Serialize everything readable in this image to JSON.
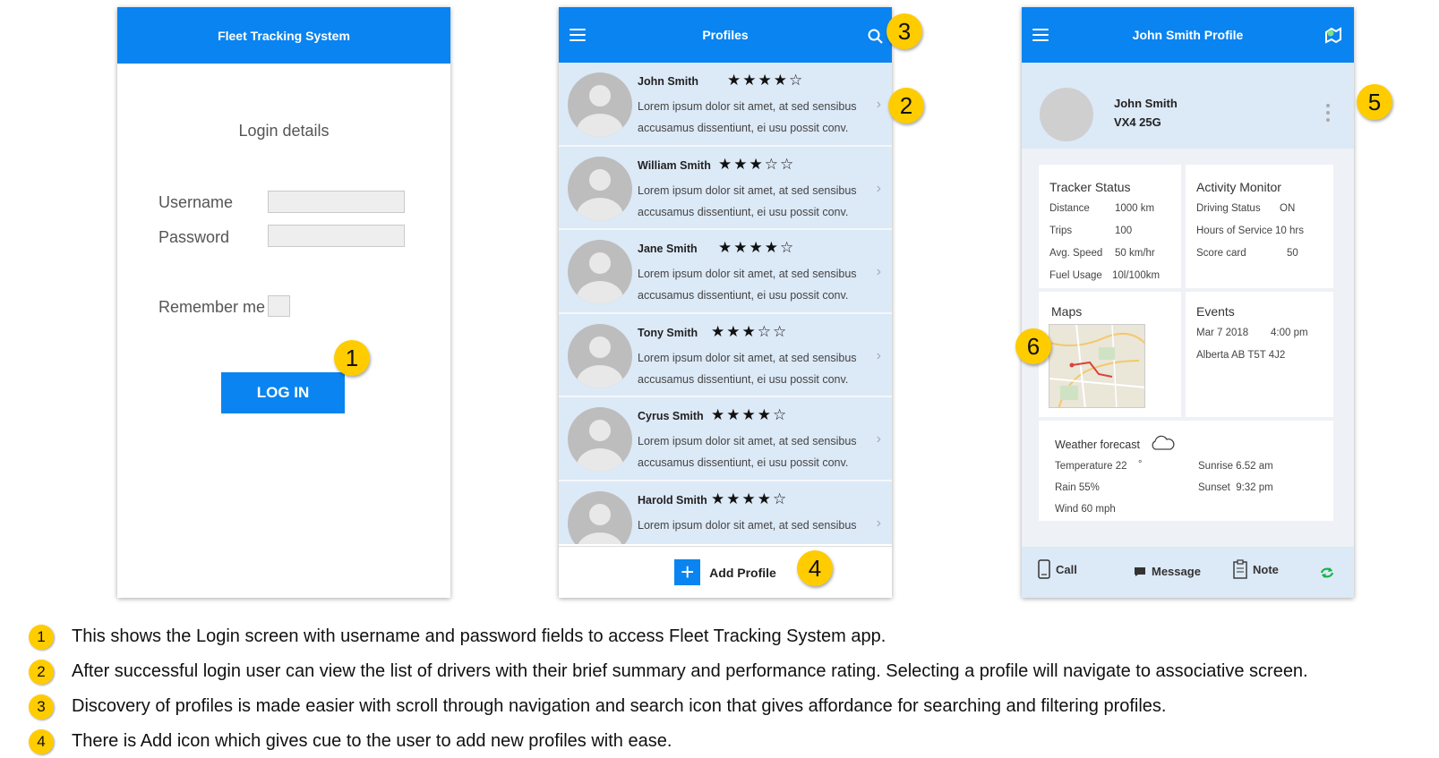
{
  "login": {
    "title": "Fleet Tracking System",
    "heading": "Login details",
    "username_label": "Username",
    "password_label": "Password",
    "remember_label": "Remember me",
    "login_button": "LOG IN"
  },
  "profiles": {
    "title": "Profiles",
    "items": [
      {
        "name": "John Smith",
        "rating": 4,
        "line1": "Lorem ipsum dolor sit amet, at sed sensibus",
        "line2": "accusamus dissentiunt, ei usu possit conv."
      },
      {
        "name": "William Smith",
        "rating": 3,
        "line1": "Lorem ipsum dolor sit amet, at sed sensibus",
        "line2": "accusamus dissentiunt, ei usu possit conv."
      },
      {
        "name": "Jane Smith",
        "rating": 4,
        "line1": "Lorem ipsum dolor sit amet, at sed sensibus",
        "line2": "accusamus dissentiunt, ei usu possit conv."
      },
      {
        "name": "Tony Smith",
        "rating": 3,
        "line1": "Lorem ipsum dolor sit amet, at sed sensibus",
        "line2": "accusamus dissentiunt, ei usu possit conv."
      },
      {
        "name": "Cyrus Smith",
        "rating": 4,
        "line1": "Lorem ipsum dolor sit amet, at sed sensibus",
        "line2": "accusamus dissentiunt, ei usu possit conv."
      },
      {
        "name": "Harold Smith",
        "rating": 4,
        "line1": "Lorem ipsum dolor sit amet, at sed sensibus",
        "line2": ""
      }
    ],
    "add_label": "Add Profile"
  },
  "detail": {
    "title": "John Smith Profile",
    "name": "John Smith",
    "plate": "VX4 25G",
    "tracker": {
      "title": "Tracker Status",
      "rows": [
        {
          "k": "Distance",
          "v": "1000 km"
        },
        {
          "k": "Trips",
          "v": "100"
        },
        {
          "k": "Avg. Speed",
          "v": "50 km/hr"
        },
        {
          "k": "Fuel Usage",
          "v": "10l/100km"
        }
      ]
    },
    "activity": {
      "title": "Activity Monitor",
      "rows": [
        {
          "k": "Driving Status",
          "v": "ON"
        },
        {
          "k": "Hours of Service",
          "v": "10 hrs"
        },
        {
          "k": "Score card",
          "v": "50"
        }
      ]
    },
    "maps_title": "Maps",
    "events": {
      "title": "Events",
      "date": "Mar 7 2018",
      "time": "4:00 pm",
      "location": "Alberta AB T5T 4J2"
    },
    "weather": {
      "title": "Weather forecast",
      "temperature": "Temperature 22",
      "rain": "Rain 55%",
      "wind": "Wind 60 mph",
      "sunrise": "Sunrise 6.52 am",
      "sunset": "Sunset  9:32 pm"
    },
    "actions": {
      "call": "Call",
      "message": "Message",
      "note": "Note"
    }
  },
  "badges": [
    "1",
    "2",
    "3",
    "4",
    "5",
    "6"
  ],
  "notes": [
    {
      "num": "1",
      "text": "This shows the Login screen with username and password fields to access Fleet Tracking System app."
    },
    {
      "num": "2",
      "text": "After successful login user can view the list of drivers with their brief summary and performance rating. Selecting a profile will navigate to associative screen."
    },
    {
      "num": "3",
      "text": "Discovery of profiles is made easier with scroll through navigation and search icon that gives affordance for searching and filtering profiles."
    },
    {
      "num": "4",
      "text": "There is Add icon which gives cue to the user to add new profiles with ease."
    }
  ],
  "colors": {
    "app_bar": "#0a84f0",
    "badge": "#ffcc00",
    "list_row": "#dce9f7"
  }
}
